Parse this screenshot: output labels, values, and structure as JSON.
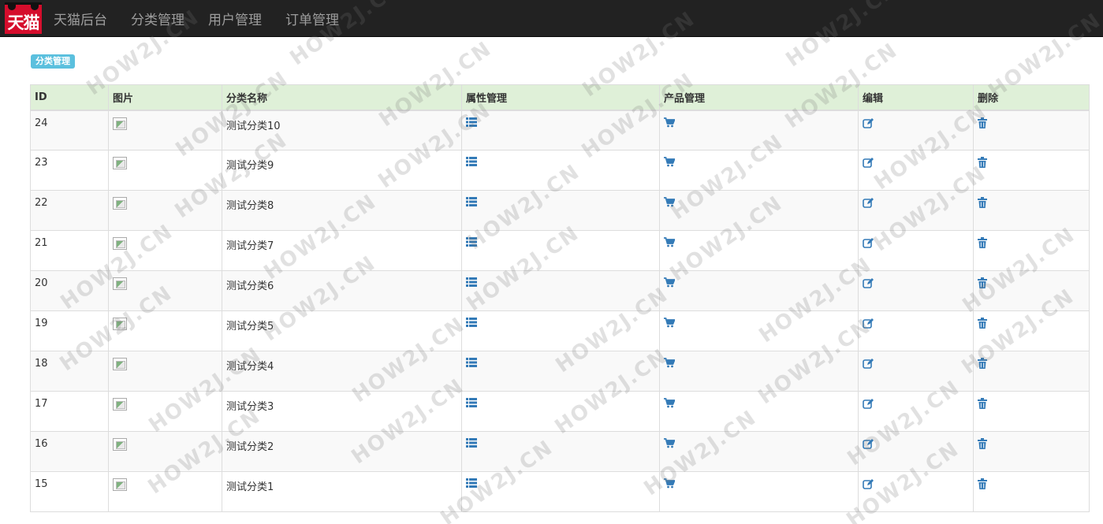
{
  "logo": {
    "text": "天猫"
  },
  "nav": {
    "items": [
      {
        "label": "天猫后台"
      },
      {
        "label": "分类管理"
      },
      {
        "label": "用户管理"
      },
      {
        "label": "订单管理"
      }
    ]
  },
  "page": {
    "badge": "分类管理"
  },
  "colors": {
    "navbar": "#222222",
    "nav_text": "#9d9d9d",
    "logo_red": "#d50d2c",
    "badge": "#5bc0de",
    "header_bg": "#dff0d8",
    "icon_blue": "#337ab7"
  },
  "table": {
    "headers": {
      "id": "ID",
      "image": "图片",
      "name": "分类名称",
      "property": "属性管理",
      "product": "产品管理",
      "edit": "编辑",
      "delete": "删除"
    },
    "icons": {
      "property": "list-icon",
      "product": "shopping-cart-icon",
      "edit": "edit-icon",
      "delete": "trash-icon",
      "image": "broken-image-icon"
    },
    "rows": [
      {
        "id": "24",
        "name": "测试分类10"
      },
      {
        "id": "23",
        "name": "测试分类9"
      },
      {
        "id": "22",
        "name": "测试分类8"
      },
      {
        "id": "21",
        "name": "测试分类7"
      },
      {
        "id": "20",
        "name": "测试分类6"
      },
      {
        "id": "19",
        "name": "测试分类5"
      },
      {
        "id": "18",
        "name": "测试分类4"
      },
      {
        "id": "17",
        "name": "测试分类3"
      },
      {
        "id": "16",
        "name": "测试分类2"
      },
      {
        "id": "15",
        "name": "测试分类1"
      }
    ]
  },
  "watermark": {
    "text": "HOW2J.CN"
  }
}
